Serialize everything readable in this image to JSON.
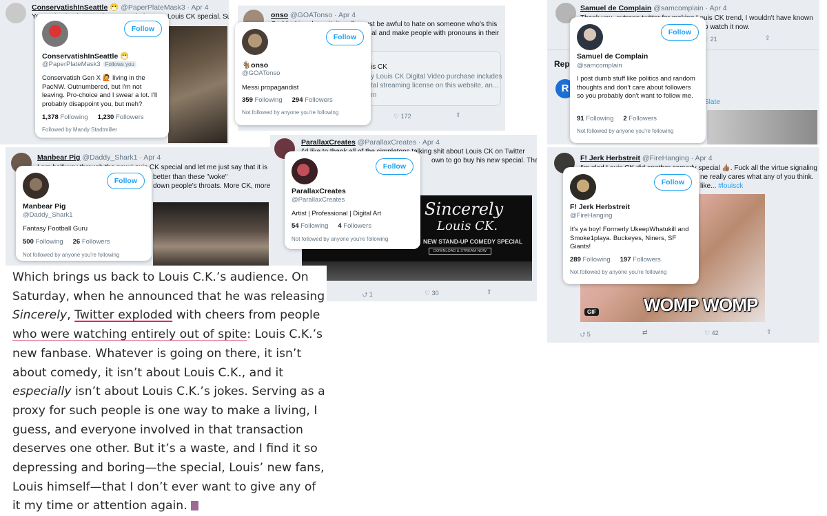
{
  "colors": {
    "accent": "#1da1f2",
    "panel": "#e9edf1",
    "highlight": "#e0245e"
  },
  "tweets": [
    {
      "name": "ConservatishInSeattle",
      "emoji": "😷",
      "handle": "@PaperPlateMask3",
      "date": "Apr 4",
      "text": "Yes, I absolutely am going to watch the new Louis CK special. Suc"
    },
    {
      "name": "onso",
      "handle": "@GOATonso",
      "date": "Apr 4",
      "text": "God fucking damn it, it really must be awful to hate on someone who's this",
      "text2": "al and make people with pronouns in their",
      "link_title": "is CK",
      "link_desc": "y Louis CK Digital Video purchase includes",
      "link_desc2": "tal streaming license on this website, an...",
      "link_domain": "m",
      "likes": "172"
    },
    {
      "name": "Samuel de Complain",
      "handle": "@samcomplain",
      "date": "Apr 4",
      "text": "Thank you, outrage twitter for making Louis CK trend, I wouldn't have known",
      "text2": "o watch it now.",
      "likes": "21",
      "rep_label": "Rep",
      "rep_link": "Slate"
    },
    {
      "name": "Manbear Pig",
      "handle": "@Daddy_Shark1",
      "date": "Apr 4",
      "text": "I am half way through the new Louis CK special and let me just say that it is",
      "text2": "better than these \"woke\"",
      "text3": "down people's throats. More CK, more"
    },
    {
      "name": "ParallaxCreates",
      "handle": "@ParallaxCreates",
      "date": "Apr 4",
      "text": "I'd like to thank all of the simpletons talking shit about Louis CK on Twitter",
      "text2": "own to go buy his new special. Thanks",
      "replies": "1",
      "likes": "30",
      "promo": {
        "title": "Sincerely",
        "subtitle": "Louis CK.",
        "line": "NEW STAND-UP COMEDY SPECIAL",
        "cta": "DOWNLOAD & STREAM NOW"
      }
    },
    {
      "name": "F! Jerk Herbstreit",
      "handle": "@FireHanging",
      "date": "Apr 4",
      "text": "I'm glad Louis CK did another comedy special 👍🏽. Fuck all the virtue signaling",
      "text2": "ne really cares what any of you think.",
      "text3": "like...",
      "hashtag": "#louisck",
      "gif_caption": "WOMP WOMP",
      "gif_badge": "GIF",
      "replies": "5",
      "likes": "42"
    }
  ],
  "cards": [
    {
      "name": "ConservatishInSeattle 😷",
      "handle": "@PaperPlateMask3",
      "follows_you": "Follows you",
      "bio": "Conservatish Gen X 🙋 living in the PacNW. Outnumbered, but I'm not leaving. Pro-choice and I swear a lot. I'll probably disappoint you, but meh?",
      "following": "1,378",
      "followers": "1,230",
      "followed_by": "Followed by Mandy Stadtmiller"
    },
    {
      "name": "🐐onso",
      "handle": "@GOATonso",
      "bio": "Messi propagandist",
      "following": "359",
      "followers": "294",
      "followed_by": "Not followed by anyone you're following"
    },
    {
      "name": "Samuel de Complain",
      "handle": "@samcomplain",
      "bio": "I post dumb stuff like politics and random thoughts and don't care about followers so you probably don't want to follow me.",
      "following": "91",
      "followers": "2",
      "followed_by": "Not followed by anyone you're following"
    },
    {
      "name": "Manbear Pig",
      "handle": "@Daddy_Shark1",
      "bio": "Fantasy Football Guru",
      "following": "500",
      "followers": "26",
      "followed_by": "Not followed by anyone you're following"
    },
    {
      "name": "ParallaxCreates",
      "handle": "@ParallaxCreates",
      "bio": "Artist | Professional | Digital Art",
      "following": "54",
      "followers": "4",
      "followed_by": "Not followed by anyone you're following"
    },
    {
      "name": "F! Jerk Herbstreit",
      "handle": "@FireHanging",
      "bio": "It's ya boy! Formerly UkeepWhatukill and Smoke1playa. Buckeyes, Niners, SF Giants!",
      "following": "289",
      "followers": "197",
      "followed_by": "Not followed by anyone you're following"
    }
  ],
  "labels": {
    "follow": "Follow",
    "following": "Following",
    "followers": "Followers"
  },
  "article": {
    "p1": "Which brings us back to Louis C.K.’s audience. On Saturday, when he announced that he was releasing ",
    "italic1": "Sincerely",
    "comma": ", ",
    "link1": "Twitter exploded",
    "p2": " with cheers from people ",
    "link2": "who were watching entirely out of spite",
    "p3": ": Louis C.K.’s new fanbase. Whatever is going on there, it isn’t about comedy, it isn’t about Louis C.K., and it ",
    "italic2": "especially",
    "p4": " isn’t about Louis C.K.’s jokes. Serving as a proxy for such people is one way to make a living, I guess, and everyone involved in that transaction deserves one other. But it’s a waste, and I find it so depressing and boring—the special, Louis’ new fans, Louis himself—that I don’t ever want to give any of it my time or attention again. "
  }
}
